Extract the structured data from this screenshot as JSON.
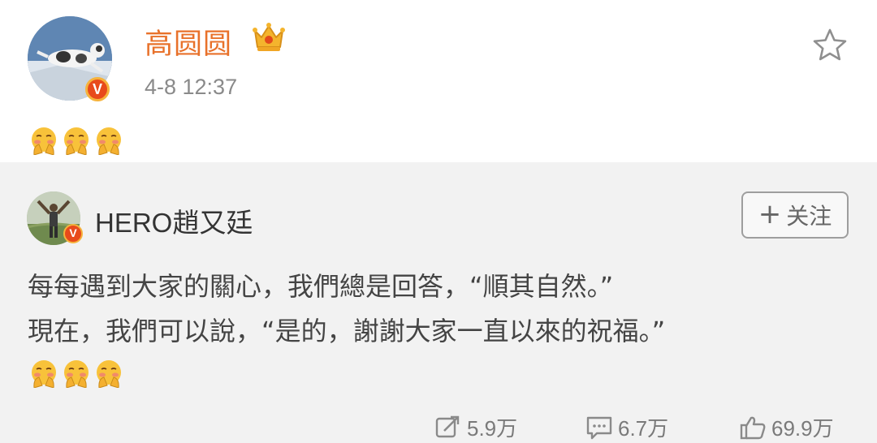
{
  "post": {
    "author_name": "高圆圆",
    "time": "4-8 12:37",
    "emoji_count": 3,
    "emoji_icon": "blushing-hands-emoji",
    "verified_icon": "verified-v-badge",
    "vip_icon": "crown-icon",
    "favorite_icon": "star-outline-icon"
  },
  "repost": {
    "author_name": "HERO趙又廷",
    "follow_label": "关注",
    "text": "每每遇到大家的關心，我們總是回答，“順其自然。”\n現在，我們可以說，“是的，謝謝大家一直以來的祝福。”",
    "emoji_count": 3
  },
  "stats": {
    "reposts": "5.9万",
    "comments": "6.7万",
    "likes": "69.9万"
  },
  "colors": {
    "author_name": "#e8712a",
    "repost_bg": "#f2f2f2",
    "verified_badge": "#e84a1b",
    "stat_text": "#7a7a7a"
  }
}
